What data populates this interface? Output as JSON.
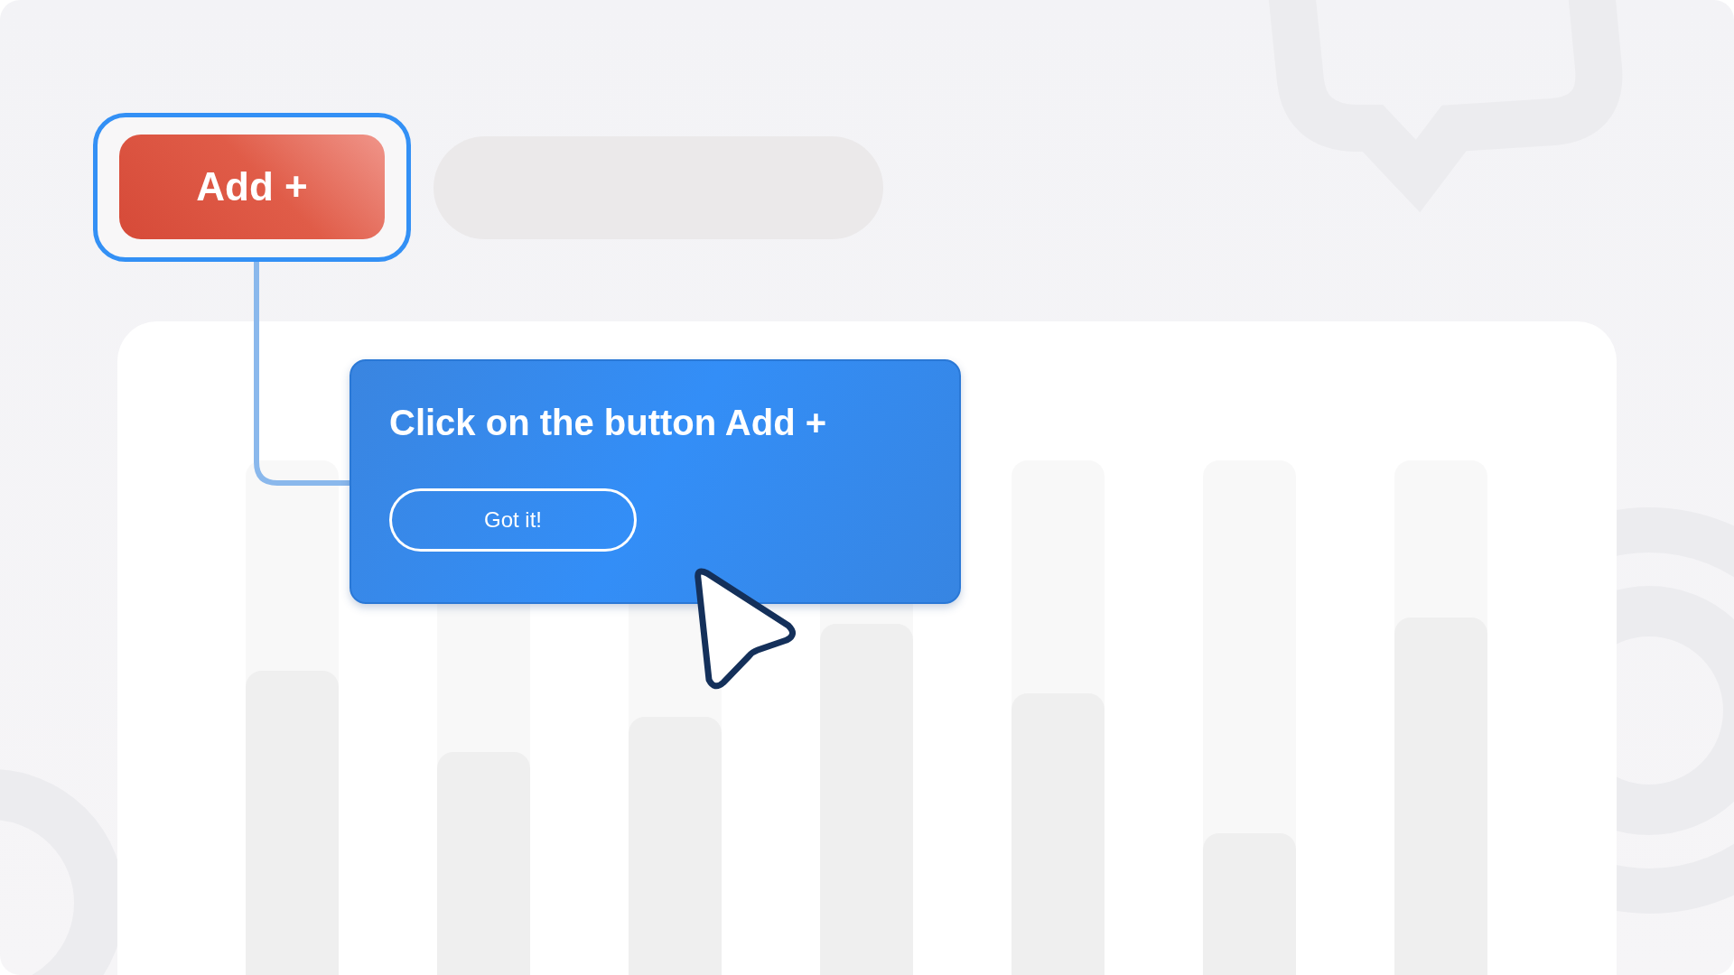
{
  "toolbar": {
    "add_button": "Add +"
  },
  "chart_placeholder": {
    "bars": [
      {
        "level": 0.64
      },
      {
        "level": 0.5
      },
      {
        "level": 0.56
      },
      {
        "level": 0.72
      },
      {
        "level": 0.6
      },
      {
        "level": 0.36
      },
      {
        "level": 0.73
      }
    ]
  },
  "tooltip": {
    "title": "Click on the button Add +",
    "button": "Got it!"
  }
}
